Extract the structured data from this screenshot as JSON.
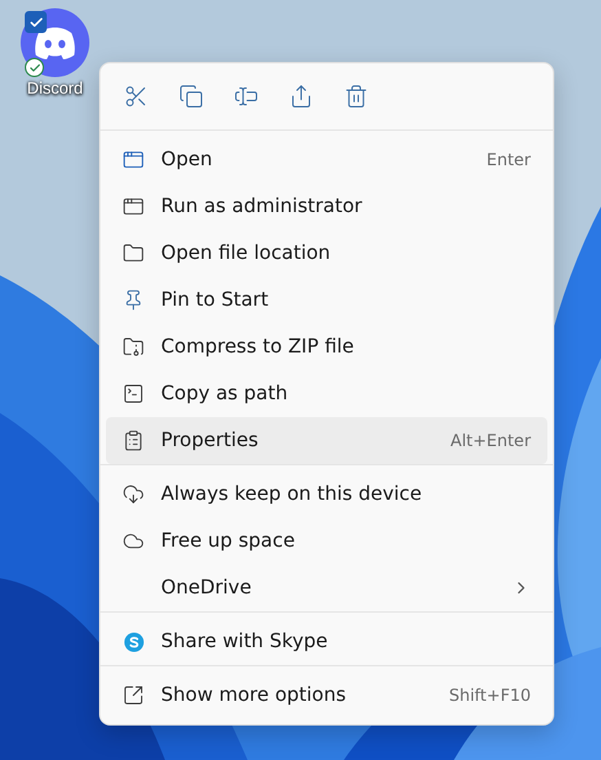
{
  "desktop_icon": {
    "label": "Discord",
    "checked": true,
    "synced": true
  },
  "context_menu": {
    "toolbar": [
      {
        "kind": "cut"
      },
      {
        "kind": "copy"
      },
      {
        "kind": "rename"
      },
      {
        "kind": "share"
      },
      {
        "kind": "delete"
      }
    ],
    "sections": [
      {
        "items": [
          {
            "kind": "open",
            "label": "Open",
            "shortcut": "Enter",
            "selected": false
          },
          {
            "kind": "admin",
            "label": "Run as administrator",
            "selected": false
          },
          {
            "kind": "folder",
            "label": "Open file location",
            "selected": false
          },
          {
            "kind": "pin",
            "label": "Pin to Start",
            "selected": false
          },
          {
            "kind": "zip",
            "label": "Compress to ZIP file",
            "selected": false
          },
          {
            "kind": "path",
            "label": "Copy as path",
            "selected": false
          },
          {
            "kind": "properties",
            "label": "Properties",
            "shortcut": "Alt+Enter",
            "selected": true
          }
        ]
      },
      {
        "items": [
          {
            "kind": "keep",
            "label": "Always keep on this device",
            "selected": false
          },
          {
            "kind": "free",
            "label": "Free up space",
            "selected": false
          },
          {
            "kind": "none",
            "label": "OneDrive",
            "submenu": true,
            "selected": false
          }
        ]
      },
      {
        "items": [
          {
            "kind": "skype",
            "label": "Share with Skype",
            "selected": false
          }
        ]
      },
      {
        "items": [
          {
            "kind": "more",
            "label": "Show more options",
            "shortcut": "Shift+F10",
            "selected": false
          }
        ]
      }
    ]
  }
}
